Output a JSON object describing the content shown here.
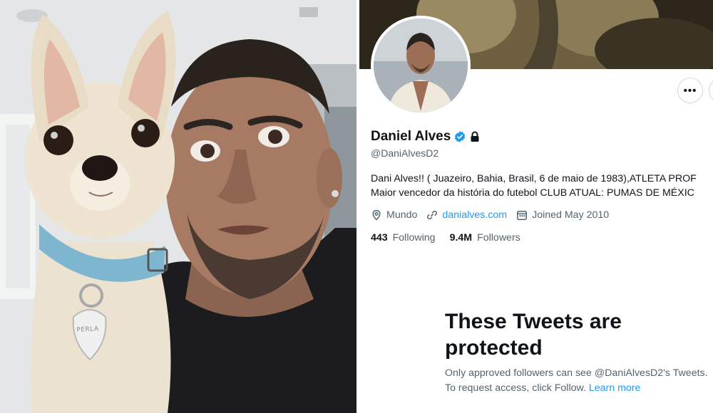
{
  "photo": {
    "tag_text": "PERLA"
  },
  "profile": {
    "display_name": "Daniel Alves",
    "handle": "@DaniAlvesD2",
    "more_label": "•••",
    "bio_line1": "Dani Alves!! ( Juazeiro, Bahia, Brasil, 6 de maio de 1983),ATLETA PROF",
    "bio_line2": "Maior vencedor da história do futebol CLUB ATUAL: PUMAS DE MÉXIC",
    "location": "Mundo",
    "website": "danialves.com",
    "joined": "Joined May 2010",
    "following_count": "443",
    "following_label": "Following",
    "followers_count": "9.4M",
    "followers_label": "Followers"
  },
  "protected": {
    "title": "These Tweets are protected",
    "body": "Only approved followers can see @DaniAlvesD2's Tweets. To request access, click Follow.",
    "learn_more": "Learn more"
  },
  "colors": {
    "accent": "#1d9bf0",
    "text_primary": "#0f1419",
    "text_secondary": "#536471"
  },
  "icons": {
    "verified": "verified-badge-icon",
    "lock": "lock-icon",
    "location": "location-pin-icon",
    "link": "link-icon",
    "calendar": "calendar-icon",
    "more": "more-horizontal-icon"
  }
}
